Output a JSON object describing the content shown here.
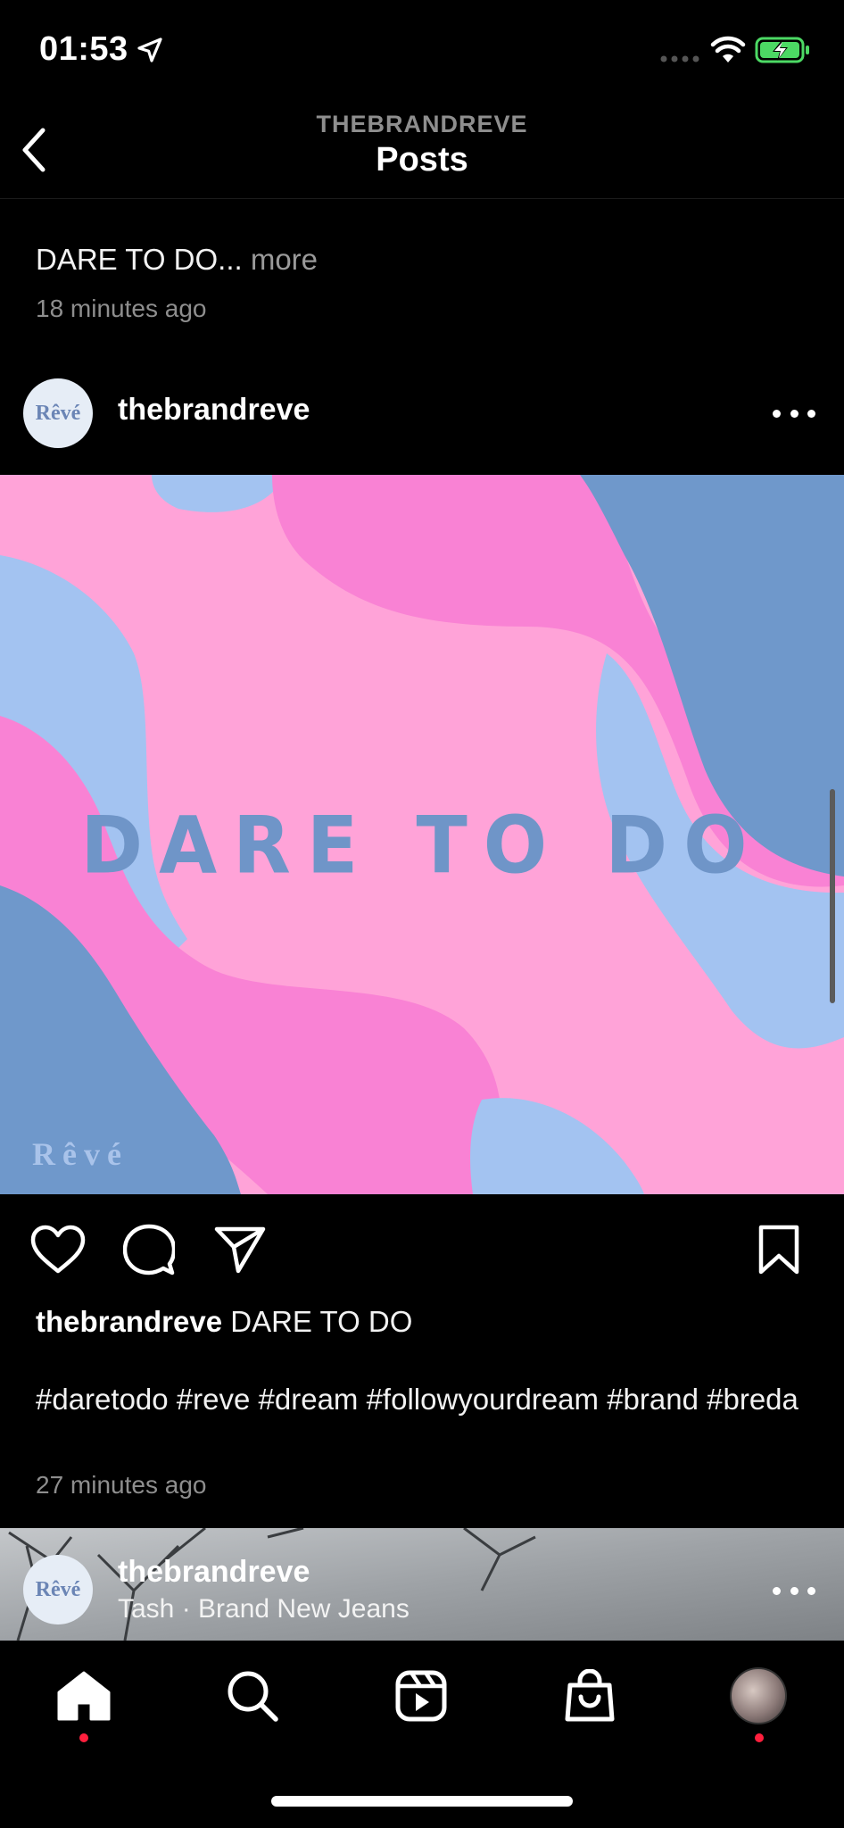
{
  "status_bar": {
    "time": "01:53"
  },
  "header": {
    "subtitle": "THEBRANDREVE",
    "title": "Posts"
  },
  "previous_post": {
    "caption": "DARE TO DO...",
    "more_label": "more",
    "timestamp": "18 minutes ago"
  },
  "post": {
    "avatar_text": "Rêvé",
    "username": "thebrandreve",
    "image_text": "DARE TO DO",
    "image_brand": "Rêvé",
    "image_colors": {
      "pink_light": "#ffa3d8",
      "pink": "#f982d4",
      "blue_light": "#a3c3f1",
      "blue": "#6f98cb"
    },
    "caption_user": "thebrandreve",
    "caption_text": "DARE TO DO",
    "hashtags": "#daretodo #reve #dream #followyourdream #brand #breda",
    "timestamp": "27 minutes ago"
  },
  "next_post": {
    "avatar_text": "Rêvé",
    "username": "thebrandreve",
    "music": "Tash · Brand New Jeans"
  },
  "tab_bar": {
    "items": [
      "home",
      "search",
      "reels",
      "shop",
      "profile"
    ],
    "notification_color": "#ff1f3d"
  }
}
